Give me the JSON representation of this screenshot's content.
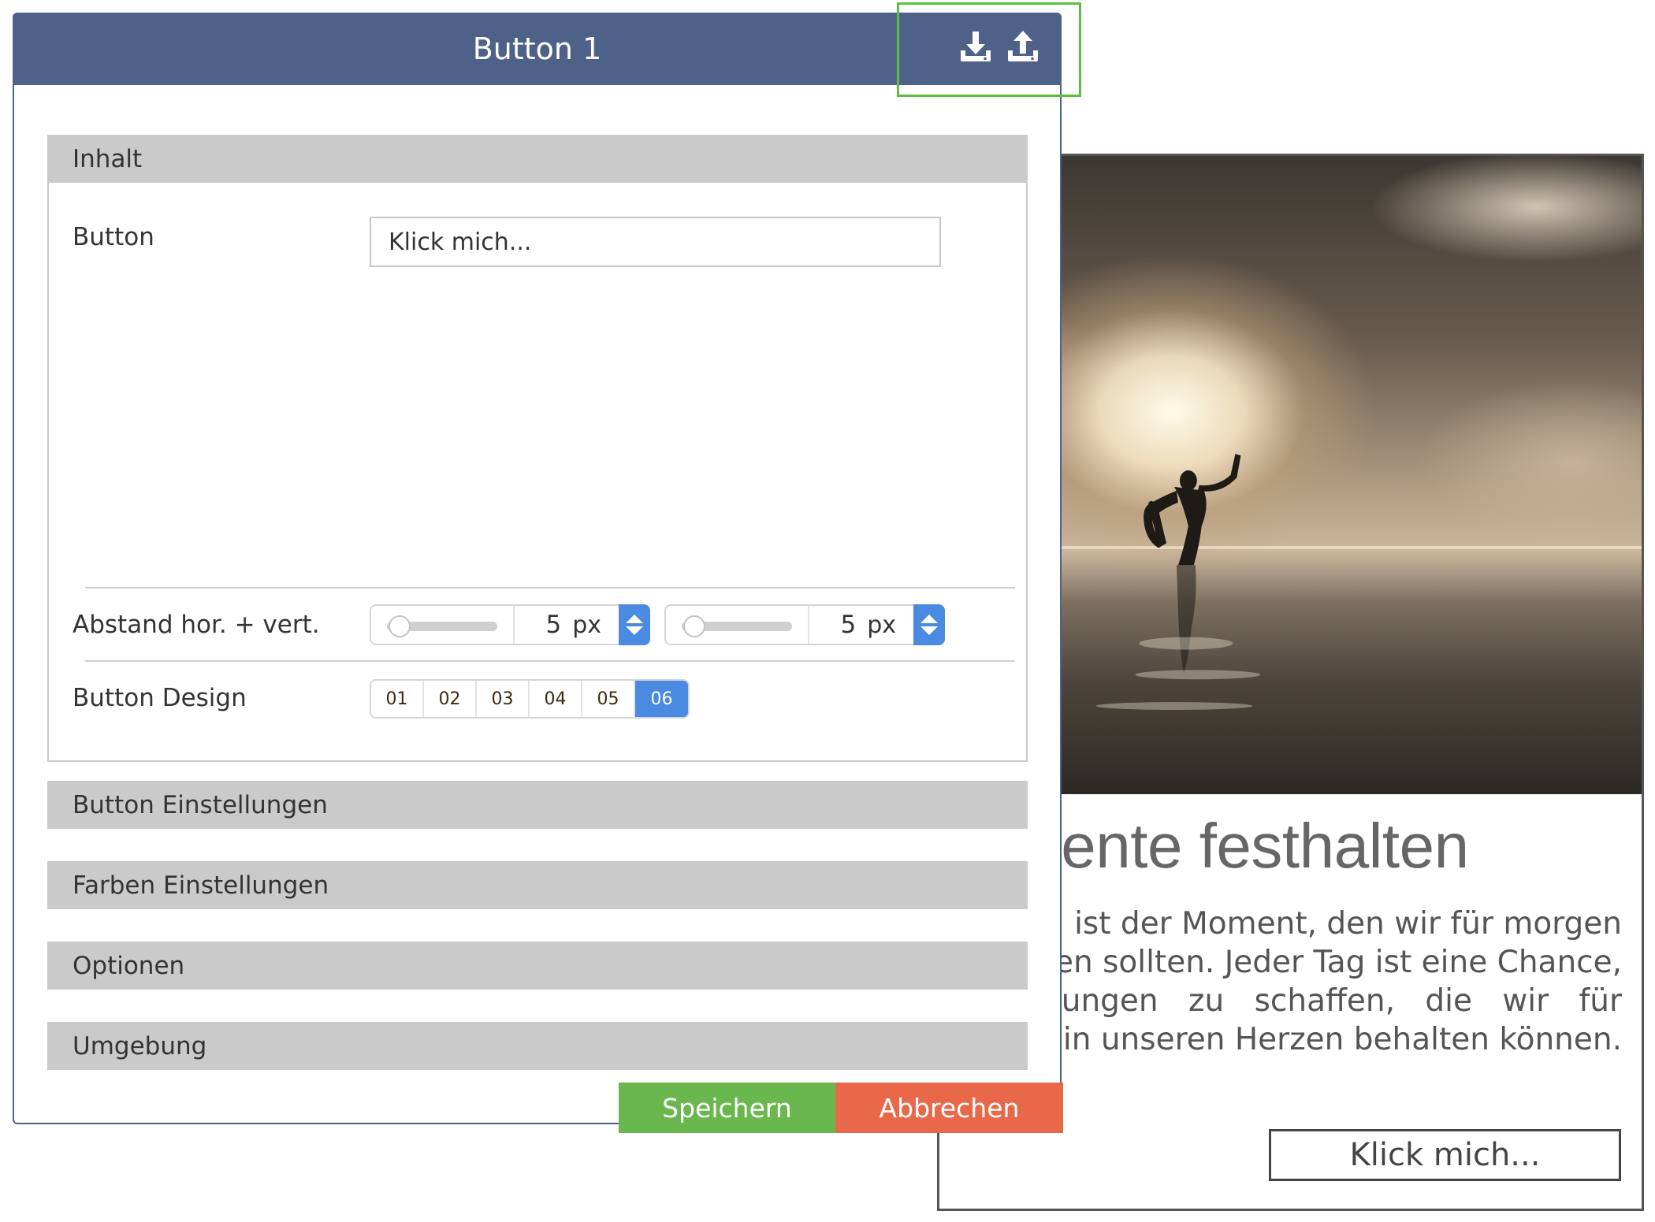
{
  "dialog": {
    "title": "Button 1",
    "icons": [
      "download-icon",
      "upload-icon"
    ],
    "header_color": "#4e6189",
    "highlight_color": "#58c23a"
  },
  "sections": {
    "inhalt": "Inhalt",
    "button_einstellungen": "Button Einstellungen",
    "farben_einstellungen": "Farben Einstellungen",
    "optionen": "Optionen",
    "umgebung": "Umgebung"
  },
  "content": {
    "button_label": "Button",
    "button_value": "Klick mich...",
    "spacing_label": "Abstand hor. + vert.",
    "spacing_horizontal": {
      "value": "5",
      "unit": "px"
    },
    "spacing_vertical": {
      "value": "5",
      "unit": "px"
    },
    "design_label": "Button Design",
    "design_options": [
      "01",
      "02",
      "03",
      "04",
      "05",
      "06"
    ],
    "design_selected": "06"
  },
  "footer": {
    "save_label": "Speichern",
    "cancel_label": "Abbrechen",
    "save_color": "#6ab84d",
    "cancel_color": "#e9684a"
  },
  "preview": {
    "title": "Momente festhalten",
    "text_lines": [
      "ist der Moment, den wir für morgen",
      "lten sollten. Jeder Tag ist eine Chance,",
      "rungen zu schaffen, die wir für",
      "in unseren Herzen behalten können."
    ],
    "button_label": "Klick mich..."
  }
}
